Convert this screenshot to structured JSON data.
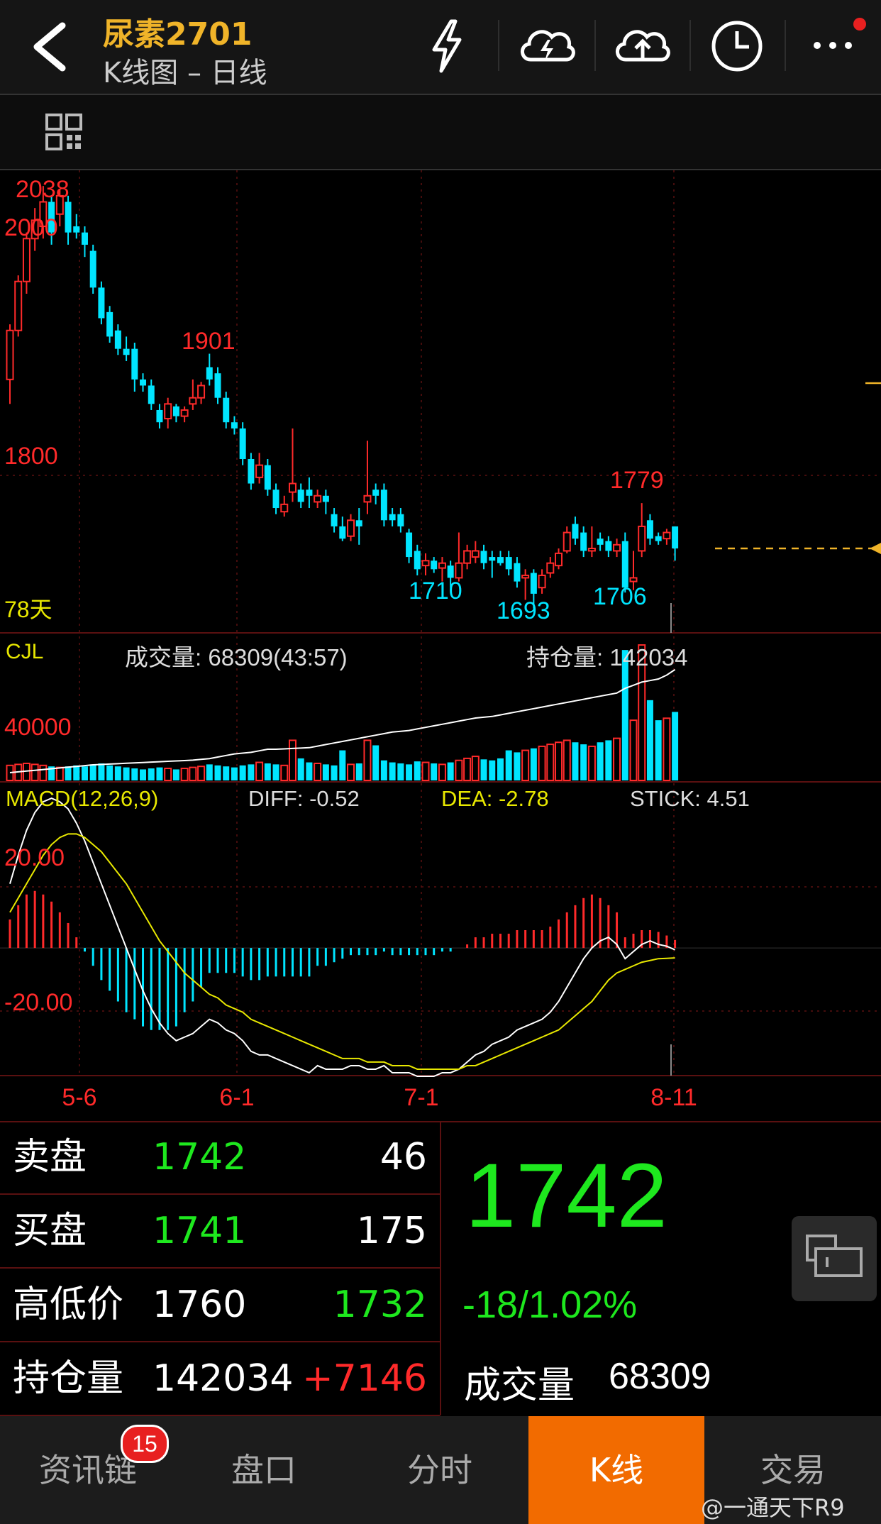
{
  "header": {
    "title": "尿素2701",
    "subtitle": "K线图 – 日线",
    "icons": [
      "back-arrow-icon",
      "flash-icon",
      "cloud-lightning-icon",
      "cloud-upload-icon",
      "clock-icon",
      "more-icon"
    ]
  },
  "toolbar": {
    "icon": "grid-icon"
  },
  "colors": {
    "up": "#ff2a2a",
    "down": "#00e5ff",
    "accent": "#f26b00",
    "title": "#f0b429",
    "green": "#1ee81e",
    "white": "#ffffff",
    "yellow": "#e8e800"
  },
  "chart": {
    "price_labels": {
      "high": "2038",
      "p2000": "2000",
      "p1901": "1901",
      "p1800": "1800",
      "p1779": "1779",
      "p1710": "1710",
      "p1693": "1693",
      "p1706": "1706",
      "days": "78天"
    },
    "volume": {
      "label": "CJL",
      "vol_text": "成交量: 68309(43:57)",
      "oi_text": "持仓量: 142034",
      "axis": "40000"
    },
    "macd": {
      "label": "MACD(12,26,9)",
      "diff": "DIFF: -0.52",
      "dea": "DEA: -2.78",
      "stick": "STICK: 4.51",
      "axis_top": "20.00",
      "axis_bottom": "-20.00"
    },
    "x_labels": [
      "5-6",
      "6-1",
      "7-1",
      "8-11"
    ]
  },
  "chart_data": {
    "type": "candlestick",
    "price_ylim": [
      1680,
      2045
    ],
    "candles": [
      [
        1880,
        1920,
        1860,
        1925
      ],
      [
        1920,
        1960,
        1915,
        1965
      ],
      [
        1960,
        1995,
        1950,
        2000
      ],
      [
        1995,
        2010,
        1985,
        2020
      ],
      [
        2005,
        2025,
        1995,
        2038
      ],
      [
        2025,
        2000,
        1990,
        2030
      ],
      [
        2015,
        2030,
        2005,
        2035
      ],
      [
        2025,
        2000,
        1990,
        2030
      ],
      [
        2005,
        2000,
        1995,
        2015
      ],
      [
        2000,
        1990,
        1980,
        2005
      ],
      [
        1985,
        1955,
        1950,
        1990
      ],
      [
        1955,
        1930,
        1925,
        1960
      ],
      [
        1935,
        1915,
        1910,
        1940
      ],
      [
        1920,
        1905,
        1900,
        1925
      ],
      [
        1905,
        1900,
        1895,
        1915
      ],
      [
        1905,
        1880,
        1870,
        1910
      ],
      [
        1880,
        1875,
        1870,
        1885
      ],
      [
        1875,
        1860,
        1855,
        1880
      ],
      [
        1855,
        1845,
        1840,
        1860
      ],
      [
        1848,
        1860,
        1840,
        1865
      ],
      [
        1858,
        1850,
        1845,
        1860
      ],
      [
        1850,
        1855,
        1845,
        1858
      ],
      [
        1860,
        1865,
        1855,
        1880
      ],
      [
        1865,
        1875,
        1860,
        1878
      ],
      [
        1890,
        1880,
        1875,
        1901
      ],
      [
        1885,
        1865,
        1860,
        1890
      ],
      [
        1865,
        1845,
        1840,
        1870
      ],
      [
        1845,
        1840,
        1835,
        1850
      ],
      [
        1840,
        1815,
        1810,
        1845
      ],
      [
        1815,
        1795,
        1790,
        1820
      ],
      [
        1800,
        1810,
        1795,
        1820
      ],
      [
        1810,
        1790,
        1785,
        1815
      ],
      [
        1790,
        1775,
        1770,
        1795
      ],
      [
        1772,
        1778,
        1768,
        1785
      ],
      [
        1788,
        1795,
        1780,
        1840
      ],
      [
        1790,
        1780,
        1775,
        1795
      ],
      [
        1790,
        1785,
        1775,
        1800
      ],
      [
        1780,
        1785,
        1775,
        1790
      ],
      [
        1785,
        1780,
        1770,
        1790
      ],
      [
        1770,
        1760,
        1755,
        1775
      ],
      [
        1760,
        1750,
        1748,
        1768
      ],
      [
        1752,
        1765,
        1748,
        1770
      ],
      [
        1765,
        1760,
        1745,
        1775
      ],
      [
        1780,
        1785,
        1770,
        1830
      ],
      [
        1790,
        1785,
        1778,
        1795
      ],
      [
        1790,
        1765,
        1760,
        1795
      ],
      [
        1770,
        1765,
        1760,
        1775
      ],
      [
        1770,
        1760,
        1755,
        1775
      ],
      [
        1755,
        1735,
        1730,
        1758
      ],
      [
        1740,
        1725,
        1720,
        1745
      ],
      [
        1728,
        1732,
        1720,
        1738
      ],
      [
        1732,
        1725,
        1722,
        1735
      ],
      [
        1726,
        1730,
        1715,
        1735
      ],
      [
        1728,
        1718,
        1710,
        1732
      ],
      [
        1718,
        1730,
        1715,
        1755
      ],
      [
        1730,
        1740,
        1725,
        1745
      ],
      [
        1735,
        1740,
        1730,
        1748
      ],
      [
        1740,
        1730,
        1725,
        1745
      ],
      [
        1735,
        1732,
        1718,
        1740
      ],
      [
        1735,
        1730,
        1728,
        1740
      ],
      [
        1735,
        1725,
        1720,
        1740
      ],
      [
        1730,
        1715,
        1710,
        1735
      ],
      [
        1718,
        1720,
        1700,
        1725
      ],
      [
        1722,
        1705,
        1693,
        1725
      ],
      [
        1710,
        1720,
        1705,
        1725
      ],
      [
        1722,
        1730,
        1718,
        1735
      ],
      [
        1728,
        1738,
        1725,
        1742
      ],
      [
        1740,
        1755,
        1738,
        1760
      ],
      [
        1762,
        1750,
        1745,
        1768
      ],
      [
        1755,
        1740,
        1735,
        1760
      ],
      [
        1740,
        1742,
        1735,
        1760
      ],
      [
        1750,
        1745,
        1740,
        1755
      ],
      [
        1748,
        1740,
        1735,
        1752
      ],
      [
        1740,
        1745,
        1735,
        1750
      ],
      [
        1748,
        1710,
        1706,
        1755
      ],
      [
        1715,
        1718,
        1708,
        1740
      ],
      [
        1740,
        1760,
        1735,
        1779
      ],
      [
        1765,
        1750,
        1745,
        1770
      ],
      [
        1752,
        1748,
        1745,
        1755
      ],
      [
        1750,
        1755,
        1745,
        1758
      ],
      [
        1760,
        1742,
        1732,
        1760
      ]
    ],
    "vol_ylim": [
      0,
      140000
    ],
    "volume": [
      15000,
      16000,
      17000,
      16000,
      15000,
      14000,
      13000,
      14000,
      15000,
      14000,
      16000,
      17000,
      15000,
      14000,
      13000,
      12000,
      11000,
      12000,
      13000,
      12000,
      11000,
      12000,
      13000,
      14000,
      16000,
      15000,
      14000,
      13000,
      15000,
      16000,
      18000,
      17000,
      16000,
      15000,
      40000,
      22000,
      18000,
      17000,
      16000,
      15000,
      30000,
      16000,
      17000,
      40000,
      35000,
      20000,
      18000,
      17000,
      16000,
      19000,
      18000,
      17000,
      16000,
      18000,
      20000,
      22000,
      24000,
      21000,
      20000,
      22000,
      30000,
      28000,
      30000,
      32000,
      34000,
      36000,
      38000,
      40000,
      38000,
      36000,
      34000,
      38000,
      40000,
      42000,
      130000,
      60000,
      135000,
      80000,
      60000,
      62000,
      68309
    ],
    "oi_ylim": [
      0,
      180000
    ],
    "open_interest": [
      10000,
      11000,
      12000,
      13000,
      14000,
      15000,
      16000,
      17000,
      18000,
      19000,
      20000,
      20500,
      21000,
      21500,
      22000,
      22500,
      23000,
      23500,
      24000,
      24500,
      25000,
      25500,
      26000,
      27000,
      28000,
      30000,
      32000,
      34000,
      35000,
      36000,
      38000,
      40000,
      40000,
      40500,
      41000,
      41500,
      42000,
      44000,
      46000,
      48000,
      50000,
      52000,
      54000,
      56000,
      58000,
      60000,
      62000,
      63000,
      64000,
      66000,
      68000,
      70000,
      72000,
      74000,
      76000,
      78000,
      80000,
      81000,
      82000,
      84000,
      86000,
      88000,
      90000,
      92000,
      94000,
      96000,
      98000,
      100000,
      102000,
      104000,
      106000,
      108000,
      110000,
      112000,
      118000,
      122000,
      126000,
      128000,
      130000,
      135000,
      142034
    ],
    "macd_ylim": [
      -35,
      45
    ],
    "macd_diff": [
      18,
      26,
      33,
      38,
      41,
      42,
      41,
      39,
      35,
      30,
      24,
      18,
      12,
      6,
      0,
      -6,
      -12,
      -17,
      -21,
      -24,
      -26,
      -25,
      -24,
      -22,
      -20,
      -21,
      -23,
      -24,
      -26,
      -29,
      -30,
      -30,
      -31,
      -32,
      -33,
      -34,
      -35,
      -33,
      -34,
      -34,
      -34,
      -33,
      -33,
      -34,
      -34,
      -33,
      -35,
      -35,
      -35,
      -36,
      -36,
      -36,
      -35,
      -35,
      -34,
      -32,
      -30,
      -29,
      -27,
      -26,
      -25,
      -23,
      -22,
      -21,
      -20,
      -18,
      -15,
      -11,
      -7,
      -3,
      0,
      2,
      3,
      1,
      -3,
      -1,
      1,
      2,
      1,
      0.5,
      -0.52
    ],
    "macd_dea": [
      10,
      14,
      18,
      22,
      26,
      29,
      31,
      32,
      32,
      31,
      29,
      27,
      24,
      21,
      18,
      14,
      10,
      6,
      2,
      -1,
      -4,
      -7,
      -9,
      -11,
      -13,
      -14,
      -16,
      -17,
      -18,
      -20,
      -21,
      -22,
      -23,
      -24,
      -25,
      -26,
      -27,
      -28,
      -29,
      -30,
      -31,
      -31,
      -31,
      -32,
      -32,
      -32,
      -33,
      -33,
      -33,
      -34,
      -34,
      -34,
      -34,
      -34,
      -34,
      -33,
      -33,
      -32,
      -31,
      -30,
      -29,
      -28,
      -27,
      -26,
      -25,
      -24,
      -23,
      -21,
      -19,
      -17,
      -15,
      -12,
      -9,
      -7,
      -6,
      -5,
      -4,
      -3.5,
      -3,
      -2.9,
      -2.78
    ],
    "macd_stick": [
      16,
      24,
      30,
      32,
      30,
      26,
      20,
      14,
      6,
      -2,
      -10,
      -18,
      -24,
      -30,
      -36,
      -40,
      -44,
      -46,
      -46,
      -46,
      -44,
      -36,
      -30,
      -22,
      -14,
      -14,
      -14,
      -14,
      -16,
      -18,
      -18,
      -16,
      -16,
      -16,
      -16,
      -16,
      -16,
      -10,
      -10,
      -8,
      -6,
      -4,
      -4,
      -4,
      -4,
      -2,
      -4,
      -4,
      -4,
      -4,
      -4,
      -4,
      -2,
      -2,
      0,
      2,
      6,
      6,
      8,
      8,
      8,
      10,
      10,
      10,
      10,
      12,
      16,
      20,
      24,
      28,
      30,
      28,
      24,
      20,
      6,
      8,
      10,
      10,
      9,
      7,
      4.51
    ],
    "x_label_positions": [
      [
        0,
        "5-6"
      ],
      [
        20,
        "6-1"
      ],
      [
        41,
        "7-1"
      ],
      [
        80,
        "8-11"
      ]
    ],
    "last_price_line": 1742
  },
  "quote": {
    "rows": [
      {
        "label": "卖盘",
        "v1": "1742",
        "v2": "46"
      },
      {
        "label": "买盘",
        "v1": "1741",
        "v2": "175"
      },
      {
        "label": "高低价",
        "v1": "1760",
        "v2": "1732"
      },
      {
        "label": "持仓量",
        "v1": "142034",
        "v2": "+7146"
      }
    ],
    "price": "1742",
    "change": "-18/1.02%",
    "volume_label": "成交量",
    "volume_value": "68309"
  },
  "nav": {
    "badge": "15",
    "tabs": [
      {
        "label": "资讯链"
      },
      {
        "label": "盘口"
      },
      {
        "label": "分时"
      },
      {
        "label": "K线"
      },
      {
        "label": "交易"
      }
    ]
  },
  "watermark": "@一通天下R9"
}
